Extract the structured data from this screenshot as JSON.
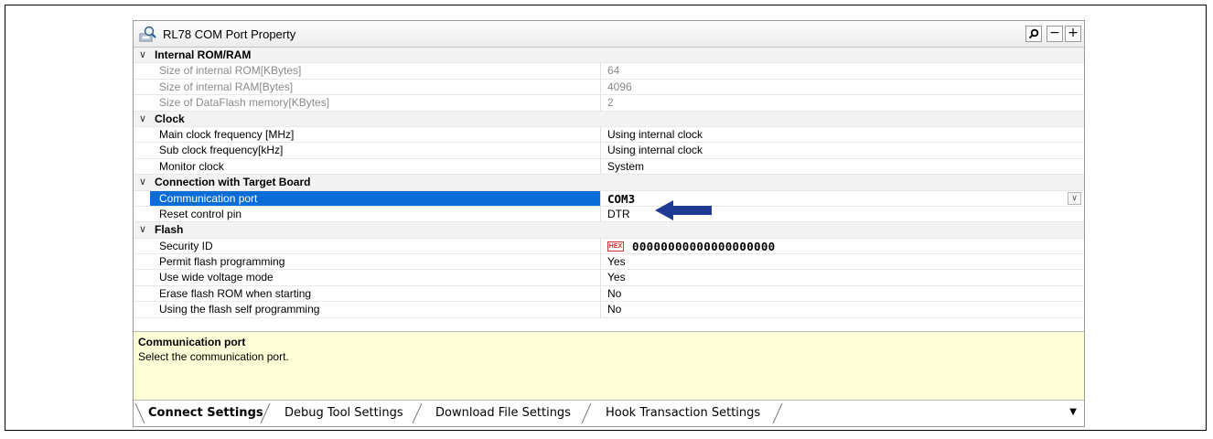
{
  "window": {
    "title": "RL78 COM Port Property",
    "search_icon": "search-icon",
    "minus_label": "−",
    "plus_label": "+"
  },
  "categories": [
    {
      "label": "Internal ROM/RAM",
      "rows": [
        {
          "name": "Size of internal ROM[KBytes]",
          "value": "64",
          "readonly": true
        },
        {
          "name": "Size of internal RAM[Bytes]",
          "value": "4096",
          "readonly": true
        },
        {
          "name": "Size of DataFlash memory[KBytes]",
          "value": "2",
          "readonly": true
        }
      ]
    },
    {
      "label": "Clock",
      "rows": [
        {
          "name": "Main clock frequency [MHz]",
          "value": "Using internal clock"
        },
        {
          "name": "Sub clock frequency[kHz]",
          "value": "Using internal clock"
        },
        {
          "name": "Monitor clock",
          "value": "System"
        }
      ]
    },
    {
      "label": "Connection with Target Board",
      "rows": [
        {
          "name": "Communication port",
          "value": "COM3",
          "selected": true
        },
        {
          "name": "Reset control pin",
          "value": "DTR"
        }
      ]
    },
    {
      "label": "Flash",
      "rows": [
        {
          "name": "Security ID",
          "value": "00000000000000000000",
          "badge": "HEX"
        },
        {
          "name": "Permit flash programming",
          "value": "Yes"
        },
        {
          "name": "Use wide voltage mode",
          "value": "Yes"
        },
        {
          "name": "Erase flash ROM when starting",
          "value": "No"
        },
        {
          "name": "Using the flash self programming",
          "value": "No"
        }
      ]
    }
  ],
  "description": {
    "title": "Communication port",
    "text": "Select the communication port."
  },
  "tabs": [
    {
      "label": "Connect Settings",
      "active": true
    },
    {
      "label": "Debug Tool Settings"
    },
    {
      "label": "Download File Settings"
    },
    {
      "label": "Hook Transaction Settings"
    }
  ],
  "colors": {
    "selection": "#0a6cd6",
    "description_bg": "#ffffd7",
    "arrow": "#1f3a93"
  }
}
